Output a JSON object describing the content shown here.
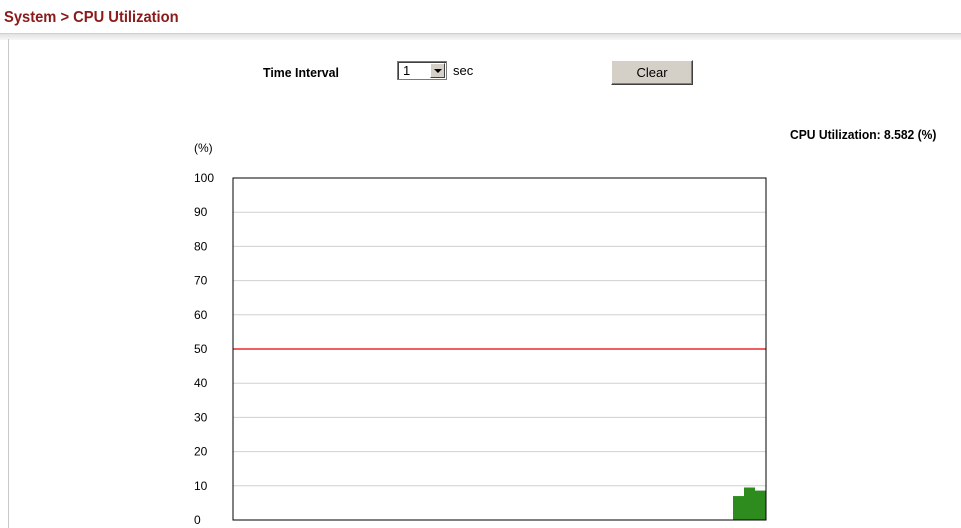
{
  "page": {
    "title": "System > CPU Utilization"
  },
  "controls": {
    "interval_label": "Time Interval",
    "interval_value": "1",
    "interval_unit": "sec",
    "clear_label": "Clear"
  },
  "status": {
    "cpu_utilization_text": "CPU Utilization: 8.582 (%)"
  },
  "colors": {
    "title": "#8b1a1a",
    "threshold_line": "#e00000",
    "bars": "#2e8b1e",
    "grid": "#d0d0d0"
  },
  "chart_data": {
    "type": "bar",
    "ylabel": "(%)",
    "ylim": [
      0,
      100
    ],
    "yticks": [
      "100",
      "90",
      "80",
      "70",
      "60",
      "50",
      "40",
      "30",
      "20",
      "10",
      "0"
    ],
    "grid": true,
    "threshold": 50,
    "values": [
      7,
      9.5,
      8.6
    ]
  }
}
